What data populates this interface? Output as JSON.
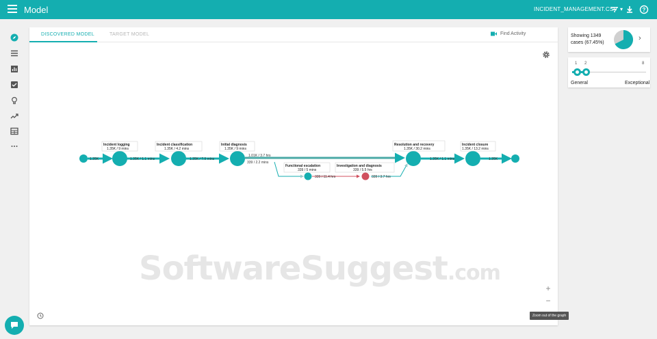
{
  "app": {
    "title": "Model",
    "dataset": "INCIDENT_MANAGEMENT.CSV"
  },
  "colors": {
    "accent": "#14aeb0",
    "exception": "#d04f5e"
  },
  "tabs": [
    {
      "label": "DISCOVERED MODEL",
      "active": true
    },
    {
      "label": "TARGET MODEL",
      "active": false
    }
  ],
  "find_activity_label": "Find Activity",
  "nav_icons": [
    "compass-icon",
    "list-icon",
    "bar-chart-icon",
    "checklist-icon",
    "lightbulb-icon",
    "trend-icon",
    "table-icon",
    "more-icon"
  ],
  "top_icons": [
    "filter-icon",
    "download-icon",
    "help-icon"
  ],
  "graph": {
    "start_edge_label": "1.35K",
    "nodes": [
      {
        "name": "Incident logging",
        "stats": "1.35K / 9 mins"
      },
      {
        "name": "Incident classification",
        "stats": "1.35K / 4.2 mins"
      },
      {
        "name": "Initial diagnosis",
        "stats": "1.35K / 9 mins"
      },
      {
        "name": "Functional escalation",
        "stats": "339 / 5 mins"
      },
      {
        "name": "Investigation and diagnosis",
        "stats": "339 / 5.5 hrs"
      },
      {
        "name": "Resolution and recovery",
        "stats": "1.35K / 30.2 mins"
      },
      {
        "name": "Incident closure",
        "stats": "1.35K / 13.2 mins"
      }
    ],
    "edges": {
      "logging_to_classification": "1.35K / 1.1 mins",
      "classification_to_diagnosis": "1.35K / 7.9 mins",
      "diagnosis_to_resolution": "1.01K / 3.7 hrs",
      "diagnosis_to_escalation": "339 / 2.2 mins",
      "escalation_to_investigation": "339 / 11.4 hrs",
      "investigation_to_resolution": "339 / 3.7 hrs",
      "resolution_to_closure": "1.35K / 1.1 mins",
      "closure_to_end": "1.35K"
    }
  },
  "watermark": {
    "main": "SoftwareSuggest",
    "suffix": ".com"
  },
  "zoom": {
    "in": "+",
    "out": "−",
    "tooltip": "Zoom out of the graph"
  },
  "cases": {
    "line1": "Showing 1349",
    "line2": "cases (67.45%)",
    "fraction": 0.6745
  },
  "variants": {
    "min_label": "1",
    "selected_label": "2",
    "max_label": "8",
    "left_label": "General",
    "right_label": "Exceptional"
  }
}
